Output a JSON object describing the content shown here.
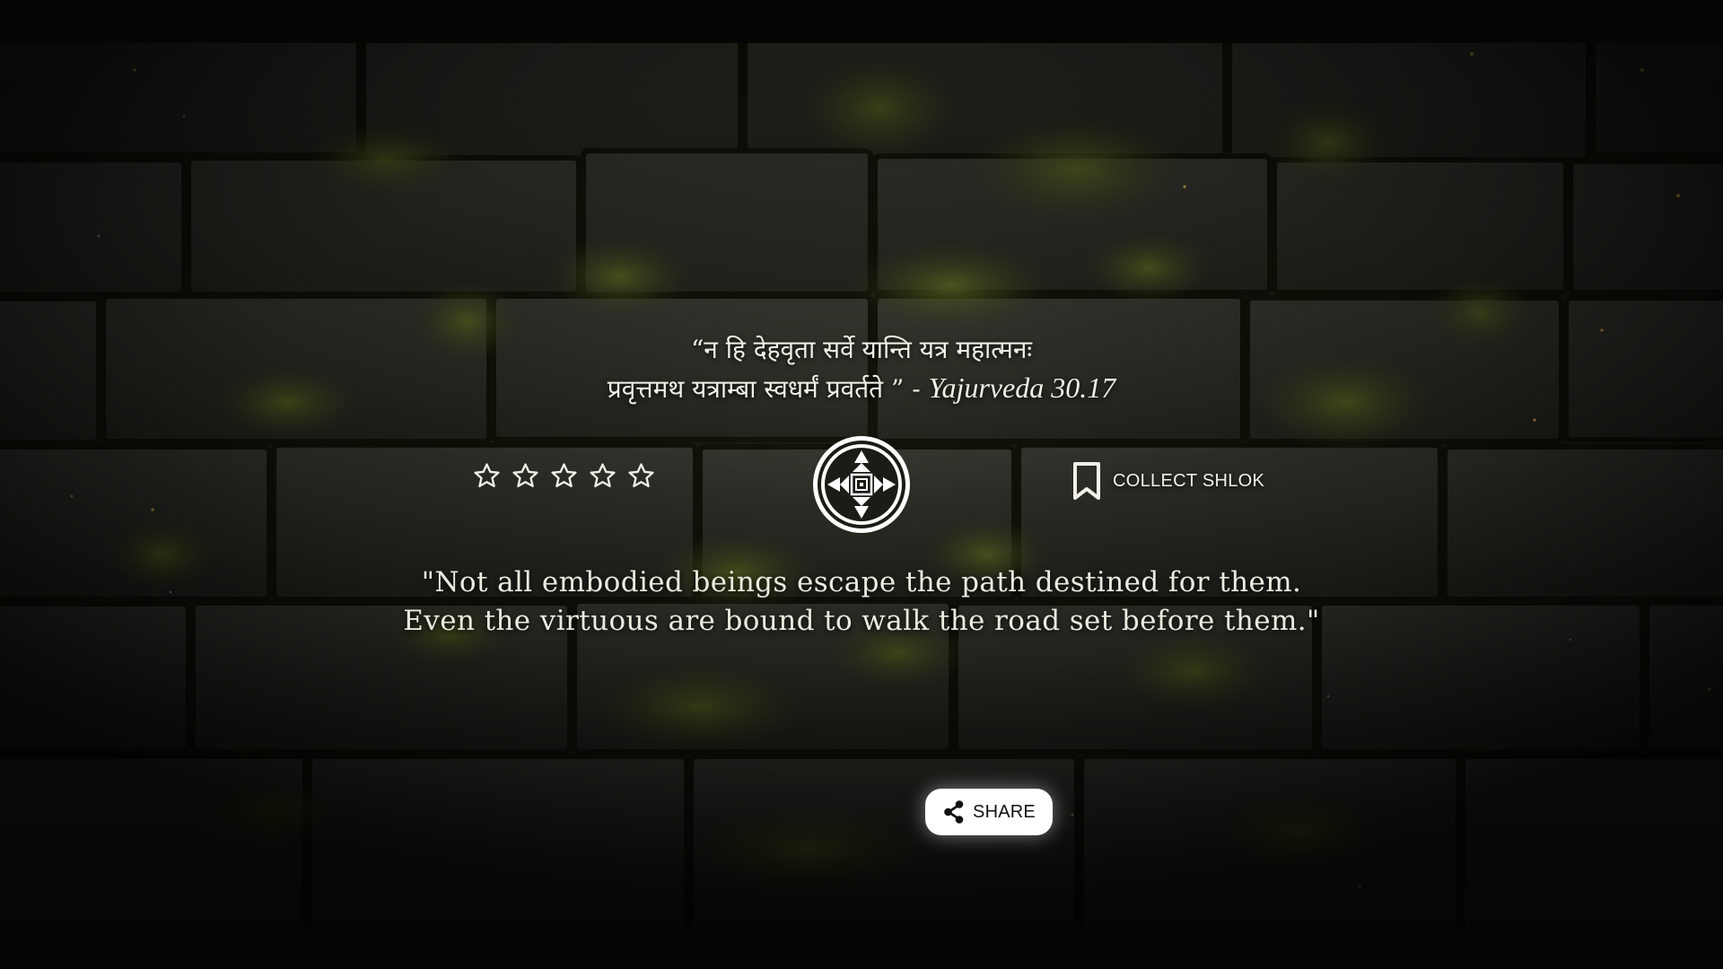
{
  "quote": {
    "sanskrit_line1": "“न हि देहवृता सर्वे यान्ति यत्र महात्मनः",
    "sanskrit_line2": "प्रवृत्तमथ यत्राम्बा स्वधर्मं प्रवर्तते  ” - ",
    "source": "Yajurveda 30.17",
    "translation_line1": "\"Not all embodied beings escape the path destined for them.",
    "translation_line2": "Even the virtuous are bound to walk the road set before them.\""
  },
  "rating": {
    "max_stars": 5,
    "selected": 0,
    "star_icon": "star-outline-icon"
  },
  "emblem": {
    "icon": "compass-mandala-icon"
  },
  "collect": {
    "label": "COLLECT SHLOK",
    "icon": "bookmark-icon"
  },
  "share": {
    "label": "SHARE",
    "icon": "share-icon"
  },
  "colors": {
    "text": "#f1efe6",
    "button_bg": "#ffffff",
    "button_text": "#111111",
    "background": "#050505",
    "moss": "#4a5a1e"
  }
}
